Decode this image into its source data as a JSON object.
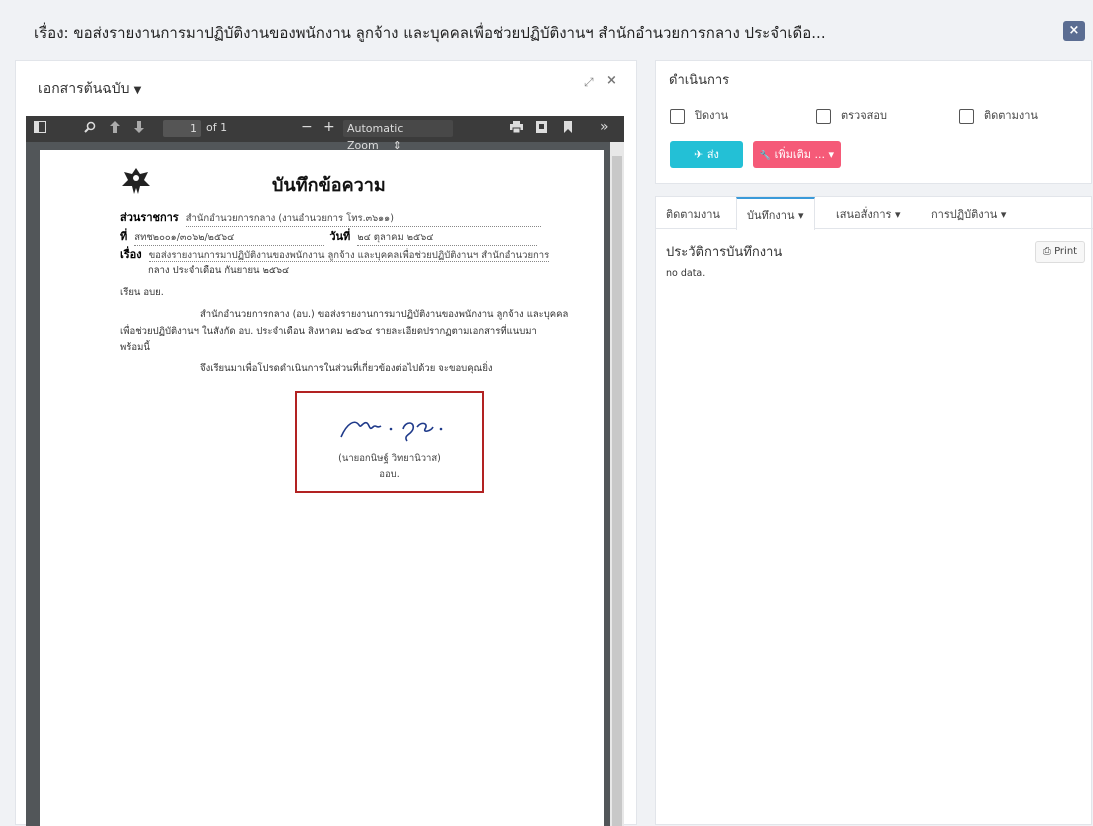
{
  "header": {
    "title": "เรื่อง: ขอส่งรายงานการมาปฏิบัติงานของพนักงาน ลูกจ้าง และบุคคลเพื่อช่วยปฏิบัติงานฯ สำนักอำนวยการกลาง ประจำเดือ...",
    "close_label": "×"
  },
  "left_panel": {
    "title": "เอกสารต้นฉบับ",
    "caret": "▼",
    "expand_icon": "⤢",
    "close_icon": "×"
  },
  "pdf_toolbar": {
    "page_input": "1",
    "page_total": "of 1",
    "zoom_minus": "−",
    "zoom_plus": "+",
    "zoom_select": "Automatic Zoom",
    "zoom_arrow": "⇕",
    "more": "»"
  },
  "document": {
    "heading": "บันทึกข้อความ",
    "agency_label": "ส่วนราชการ",
    "agency_value": "สำนักอำนวยการกลาง (งานอำนวยการ โทร.๓๖๑๑)",
    "ref_label": "ที่",
    "ref_value": "สทช๒๐๐๑/๓๐๖๒/๒๕๖๔",
    "date_label": "วันที่",
    "date_value": "๒๔ ตุลาคม ๒๕๖๔",
    "subject_label": "เรื่อง",
    "subject_value": "ขอส่งรายงานการมาปฏิบัติงานของพนักงาน ลูกจ้าง และบุคคลเพื่อช่วยปฏิบัติงานฯ สำนักอำนวยการ",
    "subject_value_2": "กลาง ประจำเดือน กันยายน ๒๕๖๔",
    "salutation": "เรียน  อบย.",
    "body_1": "สำนักอำนวยการกลาง (อบ.) ขอส่งรายงานการมาปฏิบัติงานของพนักงาน ลูกจ้าง และบุคคล",
    "body_2": "เพื่อช่วยปฏิบัติงานฯ ในสังกัด อบ. ประจำเดือน สิงหาคม ๒๕๖๔ รายละเอียดปรากฏตามเอกสารที่แนบมา",
    "body_3": "พร้อมนี้",
    "body_4": "จึงเรียนมาเพื่อโปรดดำเนินการในส่วนที่เกี่ยวข้องต่อไปด้วย จะขอบคุณยิ่ง",
    "signer_name": "(นายอกนิษฐ์ วิทยานิวาส)",
    "signer_position": "ออบ."
  },
  "actions": {
    "title": "ดำเนินการ",
    "checkbox_close": "ปิดงาน",
    "checkbox_review": "ตรวจสอบ",
    "checkbox_follow": "ติดตามงาน",
    "send_label": "ส่ง",
    "send_icon": "✈",
    "more_label": "เพิ่มเติม ...",
    "more_icon": "🔧",
    "more_caret": "▾"
  },
  "tabs": {
    "follow": "ติดตามงาน",
    "record": "บันทึกงาน",
    "propose": "เสนอสั่งการ",
    "practice": "การปฏิบัติงาน",
    "caret": "▾"
  },
  "history": {
    "title": "ประวัติการบันทึกงาน",
    "empty": "no data.",
    "print_label": "Print",
    "print_icon": "⎙"
  }
}
